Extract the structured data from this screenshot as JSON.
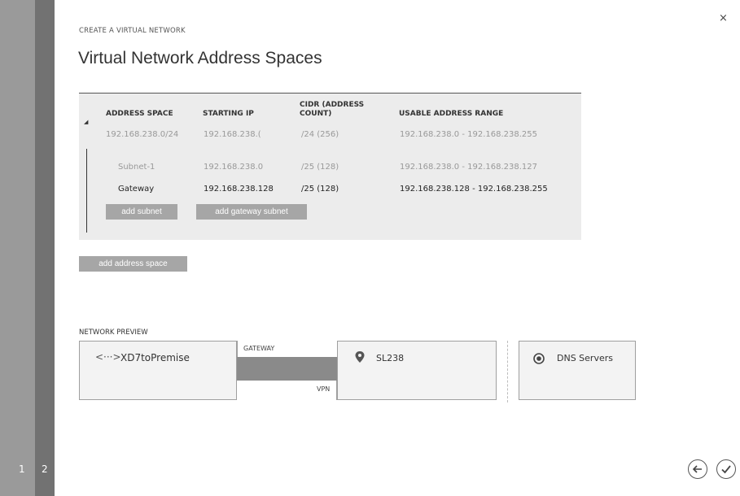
{
  "wizard": {
    "steps": [
      "1",
      "2"
    ],
    "close_glyph": "×",
    "breadcrumb": "CREATE A VIRTUAL NETWORK",
    "title": "Virtual Network Address Spaces"
  },
  "address_table": {
    "headers": {
      "address_space": "ADDRESS SPACE",
      "starting_ip": "STARTING IP",
      "cidr": "CIDR (ADDRESS COUNT)",
      "usable_range": "USABLE ADDRESS RANGE"
    },
    "rows": [
      {
        "name": "192.168.238.0/24",
        "starting_ip": "192.168.238.(",
        "cidr": "/24 (256)",
        "range": "192.168.238.0 - 192.168.238.255"
      },
      {
        "name": "Subnet-1",
        "starting_ip": "192.168.238.0",
        "cidr": "/25 (128)",
        "range": "192.168.238.0 - 192.168.238.127"
      },
      {
        "name": "Gateway",
        "starting_ip": "192.168.238.128",
        "cidr": "/25 (128)",
        "range": "192.168.238.128 - 192.168.238.255"
      }
    ],
    "add_subnet_label": "add subnet",
    "add_gateway_subnet_label": "add gateway subnet"
  },
  "add_address_space_label": "add address space",
  "network_preview": {
    "label": "NETWORK PREVIEW",
    "vnet_icon_glyph": "<···>",
    "vnet_name": "XD7toPremise",
    "gateway_label": "GATEWAY",
    "vpn_label": "VPN",
    "local_site_name": "SL238",
    "dns_label": "DNS Servers"
  },
  "icons": {
    "vnet": "virtual-network-icon",
    "site": "location-pin-icon",
    "dns": "dns-target-icon",
    "back": "back-arrow-icon",
    "finish": "checkmark-icon"
  },
  "colors": {
    "rail_light": "#9a9a9a",
    "rail_dark": "#727272",
    "panel_bg": "#ececec",
    "button_bg": "#a6a6a6",
    "tunnel": "#8a8a8a"
  }
}
